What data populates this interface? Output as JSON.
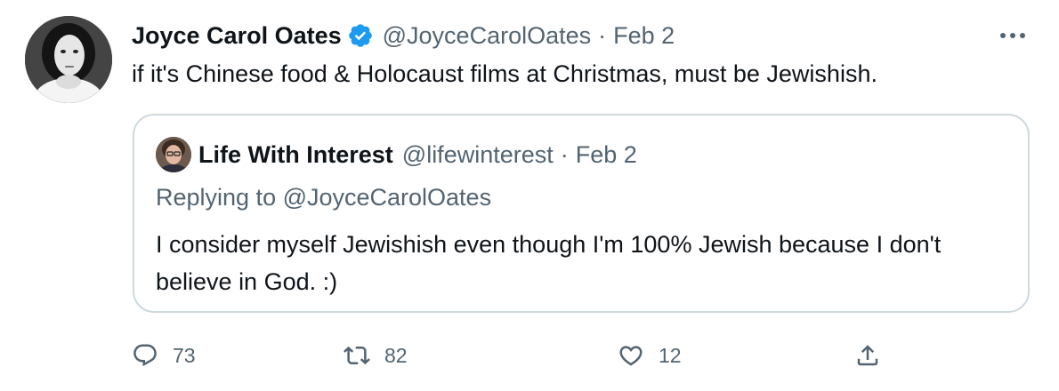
{
  "tweet": {
    "author_name": "Joyce Carol Oates",
    "author_handle": "@JoyceCarolOates",
    "separator": "·",
    "date": "Feb 2",
    "text": "if it's Chinese food & Holocaust films at Christmas, must be Jewishish.",
    "verified_icon": "verified-badge-icon",
    "more_icon": "more-dots-icon"
  },
  "quoted_tweet": {
    "author_name": "Life With Interest",
    "author_handle": "@lifewinterest",
    "separator": "·",
    "date": "Feb 2",
    "replying_to": "Replying to @JoyceCarolOates",
    "text": "I consider myself Jewishish even though I'm 100% Jewish because I don't believe in God. :)"
  },
  "actions": {
    "reply": {
      "icon": "reply-icon",
      "count": "73"
    },
    "retweet": {
      "icon": "retweet-icon",
      "count": "82"
    },
    "like": {
      "icon": "heart-icon",
      "count": "12"
    },
    "share": {
      "icon": "share-icon"
    }
  },
  "colors": {
    "text_primary": "#0f1419",
    "text_secondary": "#536471",
    "verified_blue": "#1d9bf0",
    "border": "#cfd9de"
  }
}
